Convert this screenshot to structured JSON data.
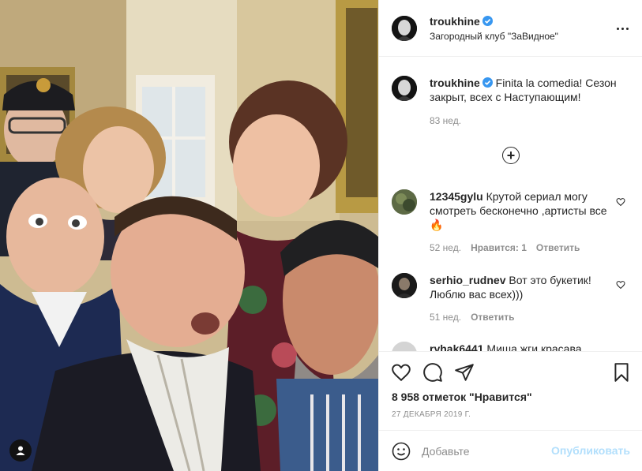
{
  "post": {
    "username": "troukhine",
    "location": "Загородный клуб \"ЗаВидное\"",
    "caption": "Finita la comedia! Сезон закрыт, всех с Наступающим!",
    "caption_time": "83 нед.",
    "likes": "8 958 отметок \"Нравится\"",
    "date": "27 ДЕКАБРЯ 2019 Г."
  },
  "comments": [
    {
      "username": "12345gylu",
      "text": "Крутой сериал могу смотреть бесконечно ,артисты все🔥",
      "time": "52 нед.",
      "likes": "Нравится: 1",
      "reply": "Ответить"
    },
    {
      "username": "serhio_rudnev",
      "text": "Вот это букетик! Люблю вас всех)))",
      "time": "51 нед.",
      "reply": "Ответить"
    },
    {
      "username": "ryhak6441",
      "text": "Миша жги красава"
    }
  ],
  "add_comment": {
    "placeholder": "Добавьте",
    "publish_label": "Опубликовать"
  },
  "icons": {
    "verified": "verified-badge-icon",
    "more": "more-horizontal-icon",
    "load_more": "plus-circle-icon",
    "heart": "heart-icon",
    "comment": "comment-icon",
    "share": "paper-plane-icon",
    "save": "bookmark-icon",
    "emoji": "emoji-icon",
    "tag": "user-tag-icon"
  },
  "colors": {
    "accent": "#0095f6",
    "publish_disabled": "#b2dffc",
    "muted": "#8e8e8e",
    "text": "#262626",
    "divider": "#efefef"
  }
}
